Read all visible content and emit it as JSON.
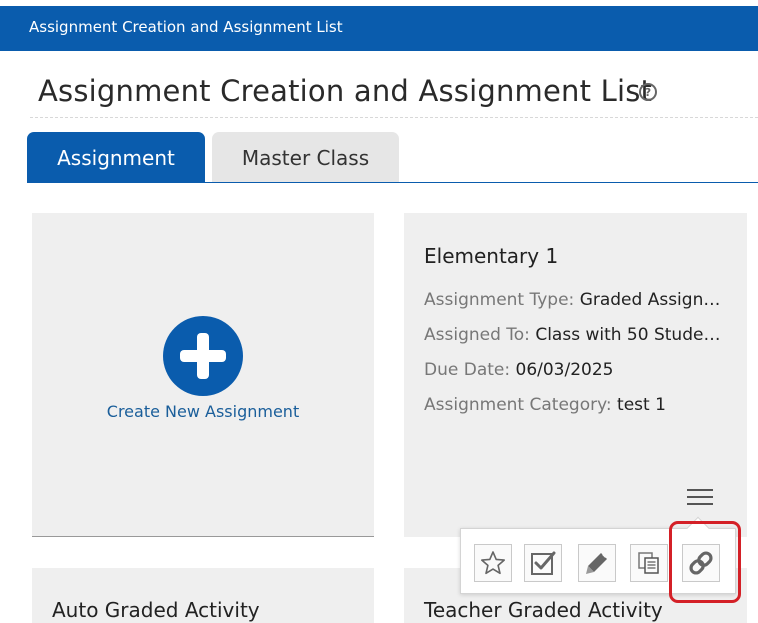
{
  "header": {
    "title": "Assignment Creation and Assignment List"
  },
  "page": {
    "title": "Assignment Creation and Assignment List",
    "help_icon": "?"
  },
  "tabs": [
    {
      "label": "Assignment",
      "active": true
    },
    {
      "label": "Master Class",
      "active": false
    }
  ],
  "create_card": {
    "label": "Create New Assignment",
    "icon": "plus-circle-icon"
  },
  "assignment_card": {
    "title": "Elementary 1",
    "fields": [
      {
        "label": "Assignment Type:",
        "value": "Graded Assignm..."
      },
      {
        "label": "Assigned To:",
        "value": "Class with 50 Student..."
      },
      {
        "label": "Due Date:",
        "value": "06/03/2025"
      },
      {
        "label": "Assignment Category:",
        "value": "test 1"
      }
    ],
    "menu_icon": "hamburger-menu-icon"
  },
  "action_menu": {
    "icons": [
      "star-icon",
      "checkbox-check-icon",
      "pencil-icon",
      "copy-icon",
      "link-icon"
    ]
  },
  "lower_cards": [
    {
      "title": "Auto Graded Activity"
    },
    {
      "title": "Teacher Graded Activity"
    }
  ],
  "colors": {
    "brand_blue": "#0a5cad",
    "highlight_red": "#d42027",
    "card_bg": "#efefef"
  }
}
